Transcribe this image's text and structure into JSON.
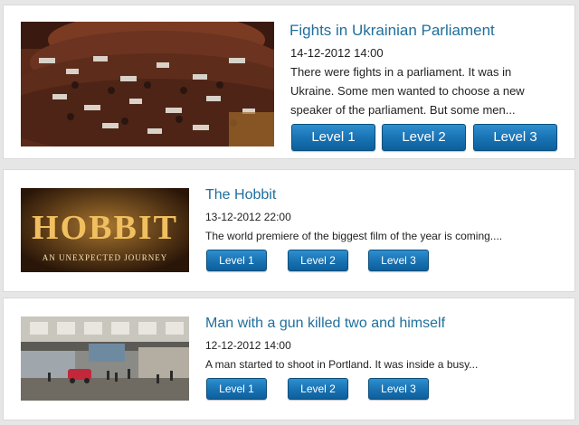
{
  "articles": [
    {
      "title": "Fights in Ukrainian Parliament",
      "date": "14-12-2012 14:00",
      "description": "There were fights in a parliament. It was in Ukraine. Some men wanted to choose a new speaker of the parliament. But some men...",
      "image_icon": "parliament-photo",
      "buttons": [
        "Level 1",
        "Level 2",
        "Level 3"
      ]
    },
    {
      "title": "The Hobbit",
      "date": "13-12-2012 22:00",
      "description": "The world premiere of the biggest film of the year is coming....",
      "image_icon": "hobbit-poster",
      "image_text": {
        "main": "HOBBIT",
        "sub": "AN UNEXPECTED JOURNEY"
      },
      "buttons": [
        "Level 1",
        "Level 2",
        "Level 3"
      ]
    },
    {
      "title": "Man with a gun killed two and himself",
      "date": "12-12-2012 14:00",
      "description": "A man started to shoot in Portland. It was inside a busy...",
      "image_icon": "shopping-mall-photo",
      "buttons": [
        "Level 1",
        "Level 2",
        "Level 3"
      ]
    }
  ],
  "colors": {
    "title": "#1f6f9c",
    "button": "#1a74b4",
    "background": "#e6e6e6"
  }
}
